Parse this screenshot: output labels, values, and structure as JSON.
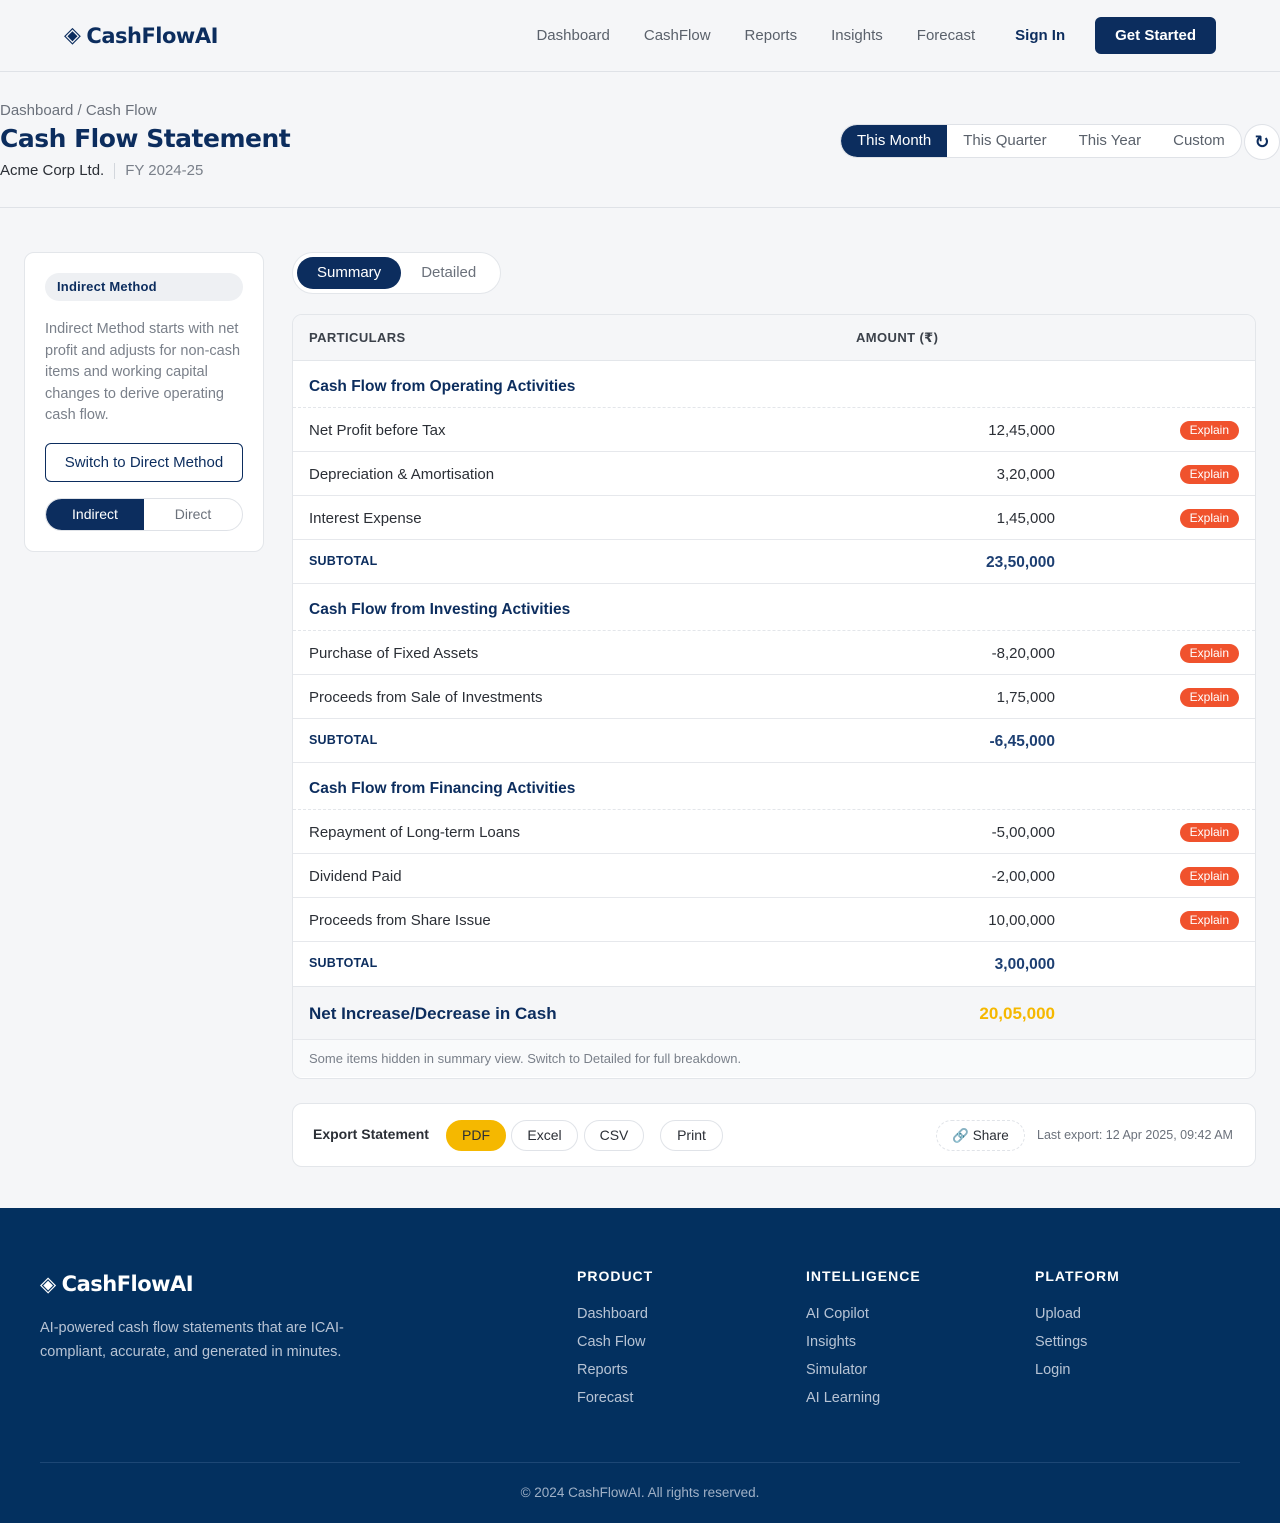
{
  "header": {
    "logo": "CashFlowAI",
    "nav": [
      "Dashboard",
      "CashFlow",
      "Reports",
      "Insights",
      "Forecast"
    ],
    "sign_in": "Sign In",
    "get_started": "Get Started"
  },
  "title": {
    "breadcrumb": "Dashboard / Cash Flow",
    "page_title": "Cash Flow Statement",
    "company": "Acme Corp Ltd.",
    "fy": "FY 2024-25",
    "periods": [
      "This Month",
      "This Quarter",
      "This Year",
      "Custom"
    ],
    "selected_period": "This Month",
    "refresh_icon": "↻"
  },
  "sidebar": {
    "method_tag": "Indirect Method",
    "description": "Indirect Method starts with net profit and adjusts for non-cash items and working capital changes to derive operating cash flow.",
    "switch_button": "Switch to Direct Method",
    "toggle": [
      "Indirect",
      "Direct"
    ]
  },
  "view_toggle": [
    "Summary",
    "Detailed"
  ],
  "table": {
    "col_particulars": "PARTICULARS",
    "col_amount": "AMOUNT (₹)",
    "explain_label": "Explain",
    "subtotal_label": "SUBTOTAL",
    "operating": {
      "title": "Cash Flow from Operating Activities",
      "items": [
        {
          "label": "Net Profit before Tax",
          "amount": "12,45,000"
        },
        {
          "label": "Depreciation & Amortisation",
          "amount": "3,20,000"
        },
        {
          "label": "Interest Expense",
          "amount": "1,45,000"
        }
      ],
      "subtotal": "23,50,000"
    },
    "investing": {
      "title": "Cash Flow from Investing Activities",
      "items": [
        {
          "label": "Purchase of Fixed Assets",
          "amount": "-8,20,000"
        },
        {
          "label": "Proceeds from Sale of Investments",
          "amount": "1,75,000"
        }
      ],
      "subtotal": "-6,45,000"
    },
    "financing": {
      "title": "Cash Flow from Financing Activities",
      "items": [
        {
          "label": "Repayment of Long-term Loans",
          "amount": "-5,00,000"
        },
        {
          "label": "Dividend Paid",
          "amount": "-2,00,000"
        },
        {
          "label": "Proceeds from Share Issue",
          "amount": "10,00,000"
        }
      ],
      "subtotal": "3,00,000"
    },
    "net_label": "Net Increase/Decrease in Cash",
    "net_amount": "20,05,000",
    "note": "Some items hidden in summary view. Switch to Detailed for full breakdown."
  },
  "export": {
    "title": "Export Statement",
    "pdf": "PDF",
    "excel": "Excel",
    "csv": "CSV",
    "print": "Print",
    "share": "🔗 Share",
    "last_export": "Last export: 12 Apr 2025, 09:42 AM"
  },
  "footer": {
    "logo": "CashFlowAI",
    "description": "AI-powered cash flow statements that are ICAI-compliant, accurate, and generated in minutes.",
    "product": {
      "heading": "PRODUCT",
      "links": [
        "Dashboard",
        "Cash Flow",
        "Reports",
        "Forecast"
      ]
    },
    "intelligence": {
      "heading": "INTELLIGENCE",
      "links": [
        "AI Copilot",
        "Insights",
        "Simulator",
        "AI Learning"
      ]
    },
    "platform": {
      "heading": "PLATFORM",
      "links": [
        "Upload",
        "Settings",
        "Login"
      ]
    },
    "copyright": "© 2024 CashFlowAI. All rights reserved."
  },
  "colors": {
    "brand": "#0c2d5e",
    "accent": "#f5b800",
    "explain": "#f0522d",
    "footer_bg": "#03305f"
  }
}
